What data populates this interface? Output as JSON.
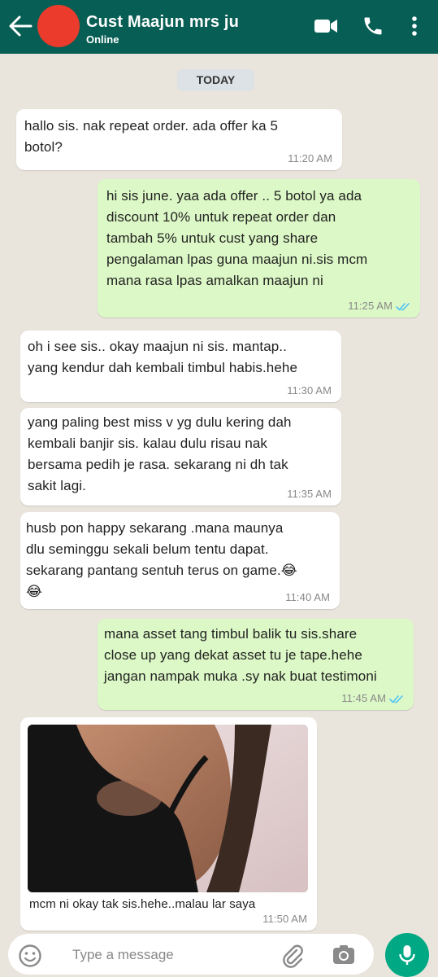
{
  "header": {
    "contact_name": "Cust Maajun mrs ju",
    "status": "Online",
    "icons": [
      "back-arrow-icon",
      "avatar",
      "video-call-icon",
      "phone-icon",
      "more-menu-icon"
    ],
    "color": "#075e54"
  },
  "date_chip": "TODAY",
  "messages": [
    {
      "direction": "in",
      "text": "hallo sis. nak repeat order. ada offer ka 5\nbotol?",
      "time": "11:20 AM"
    },
    {
      "direction": "out",
      "text": "hi sis june. yaa ada offer .. 5 botol ya ada\ndiscount 10% untuk repeat order dan\ntambah 5% untuk cust yang share\npengalaman lpas guna maajun ni.sis mcm\nmana rasa lpas amalkan maajun ni",
      "time": "11:25 AM",
      "status": "read"
    },
    {
      "direction": "in",
      "text": "oh i see sis.. okay maajun ni sis. mantap..\nyang kendur dah kembali timbul habis.hehe",
      "time": "11:30 AM"
    },
    {
      "direction": "in",
      "text": "yang paling best miss v yg dulu kering dah\nkembali banjir sis. kalau dulu risau nak\nbersama pedih je rasa. sekarang ni dh tak\nsakit lagi.",
      "time": "11:35 AM"
    },
    {
      "direction": "in",
      "text": "husb pon happy sekarang .mana maunya\ndlu seminggu sekali belum tentu dapat.\nsekarang pantang sentuh terus on game.😂\n😂",
      "time": "11:40 AM"
    },
    {
      "direction": "out",
      "text": "mana asset tang timbul balik tu sis.share\nclose up yang dekat asset tu je tape.hehe\njangan nampak muka .sy nak buat testimoni",
      "time": "11:45 AM",
      "status": "read"
    },
    {
      "direction": "in",
      "type": "image",
      "caption": "mcm ni okay tak sis.hehe..malau lar saya",
      "time": "11:50 AM"
    }
  ],
  "composer": {
    "placeholder": "Type a message",
    "icons": [
      "emoji-icon",
      "attach-icon",
      "camera-icon",
      "mic-icon"
    ]
  },
  "colors": {
    "incoming_bubble": "#ffffff",
    "outgoing_bubble": "#dcf8c6",
    "read_tick": "#4fc3f7",
    "mic_button": "#00a884"
  }
}
